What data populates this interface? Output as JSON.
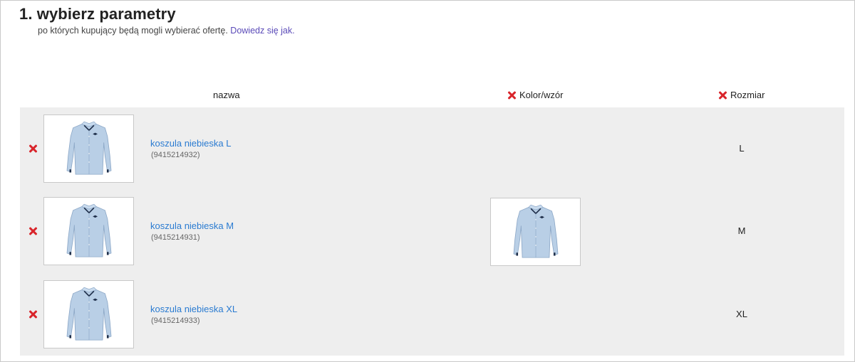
{
  "header": {
    "title": "1. wybierz parametry",
    "subtitle": "po których kupujący będą mogli wybierać ofertę.",
    "help_link": "Dowiedz się jak."
  },
  "columns": {
    "name": "nazwa",
    "color": "Kolor/wzór",
    "size": "Rozmiar"
  },
  "rows": [
    {
      "name": "koszula niebieska L",
      "id": "(9415214932)",
      "size": "L",
      "image": "shirt-icon",
      "color_image": false
    },
    {
      "name": "koszula niebieska M",
      "id": "(9415214931)",
      "size": "M",
      "image": "shirt-icon",
      "color_image": true
    },
    {
      "name": "koszula niebieska XL",
      "id": "(9415214933)",
      "size": "XL",
      "image": "shirt-icon",
      "color_image": false
    }
  ],
  "colors": {
    "accent_link": "#2a7bd1",
    "help_link": "#5a4ab8",
    "remove_icon": "#d9252b",
    "table_background": "#eeeeee",
    "shirt": "#b9cfe6"
  }
}
